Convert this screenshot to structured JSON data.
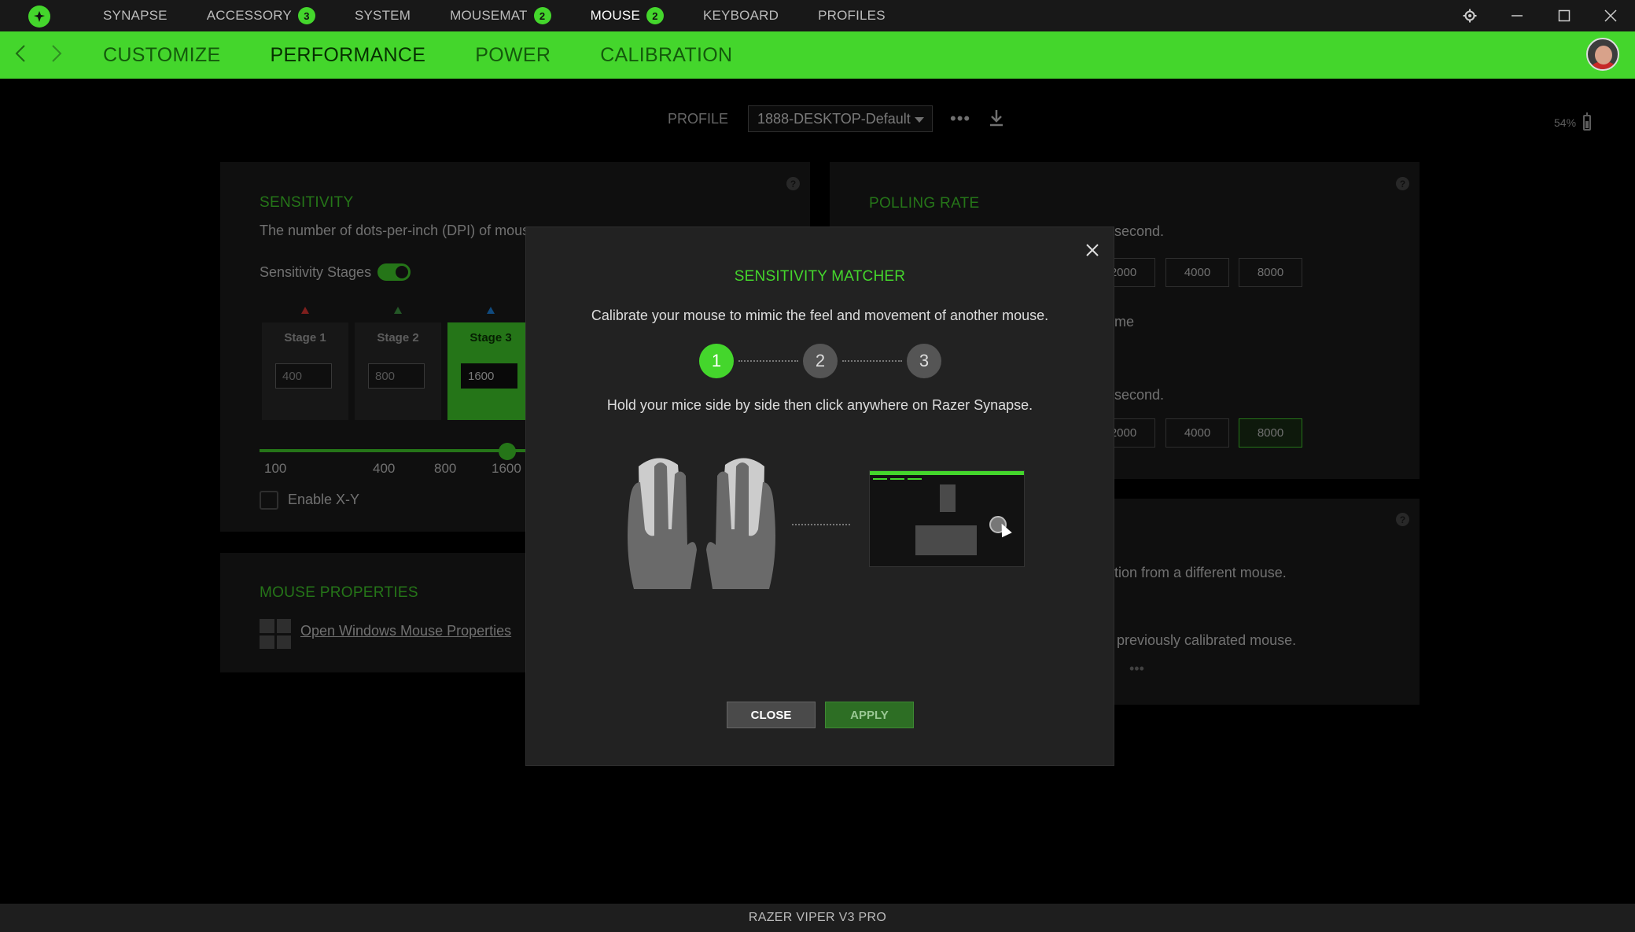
{
  "topnav": {
    "items": [
      {
        "label": "SYNAPSE"
      },
      {
        "label": "ACCESSORY",
        "badge": "3"
      },
      {
        "label": "SYSTEM"
      },
      {
        "label": "MOUSEMAT",
        "badge": "2"
      },
      {
        "label": "MOUSE",
        "badge": "2",
        "active": true
      },
      {
        "label": "KEYBOARD"
      },
      {
        "label": "PROFILES"
      }
    ]
  },
  "subnav": {
    "tabs": [
      "CUSTOMIZE",
      "PERFORMANCE",
      "POWER",
      "CALIBRATION"
    ],
    "active_tab": "PERFORMANCE"
  },
  "profile": {
    "label": "PROFILE",
    "selected": "1888-DESKTOP-Default",
    "more": "•••"
  },
  "battery": {
    "percent": "54%"
  },
  "sensitivity": {
    "title": "SENSITIVITY",
    "description": "The number of dots-per-inch (DPI) of mouse",
    "stages_label": "Sensitivity Stages",
    "stages_enabled": true,
    "stages": [
      {
        "label": "Stage 1",
        "value": "400",
        "color": "#e53935"
      },
      {
        "label": "Stage 2",
        "value": "800",
        "color": "#43a047"
      },
      {
        "label": "Stage 3",
        "value": "1600",
        "color": "#1e88e5",
        "active": true
      }
    ],
    "slider_ticks": [
      "100",
      "400",
      "800",
      "1600"
    ],
    "enable_xy": "Enable X-Y"
  },
  "mouse_properties": {
    "title": "MOUSE PROPERTIES",
    "link": "Open Windows Mouse Properties"
  },
  "polling": {
    "title": "POLLING RATE",
    "line1": "second.",
    "row1": [
      "2000",
      "4000",
      "8000"
    ],
    "line2": "me",
    "line3": "second.",
    "row2": [
      "2000",
      "4000",
      "8000"
    ],
    "row2_selected": "8000"
  },
  "third_card": {
    "line1": "tion from a different mouse.",
    "line2": "previously calibrated mouse.",
    "more": "•••"
  },
  "modal": {
    "title": "SENSITIVITY MATCHER",
    "subtitle": "Calibrate your mouse to mimic the feel and movement of another mouse.",
    "steps": [
      "1",
      "2",
      "3"
    ],
    "current_step": 1,
    "instruction": "Hold your mice side by side then click anywhere on Razer Synapse.",
    "close_label": "CLOSE",
    "apply_label": "APPLY"
  },
  "status": {
    "device": "RAZER VIPER V3 PRO"
  },
  "colors": {
    "accent": "#44d62c"
  }
}
